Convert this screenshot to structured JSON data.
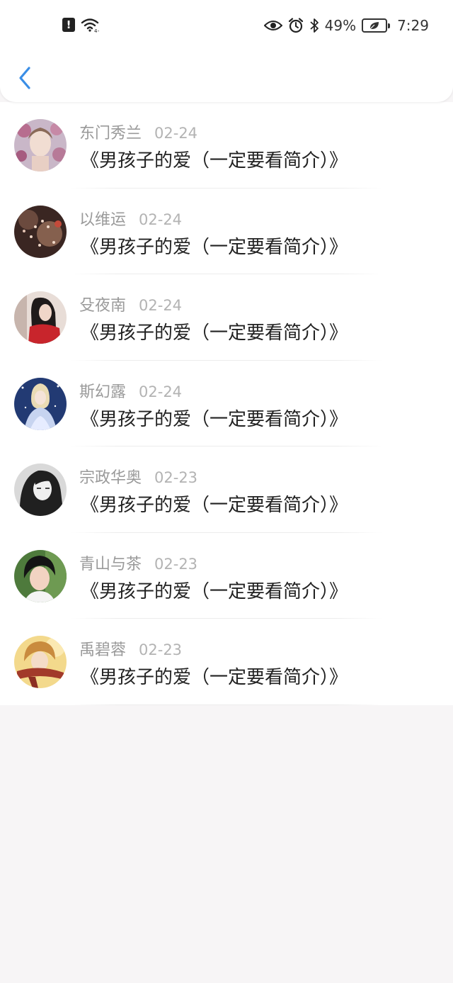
{
  "status_bar": {
    "battery": "49%",
    "time": "7:29"
  },
  "header": {
    "back_icon": "chevron-left-icon",
    "accent_color": "#3a8ee6"
  },
  "posts": [
    {
      "author": "东门秀兰",
      "date": "02-24",
      "title": "《男孩子的爱（一定要看简介）》"
    },
    {
      "author": "以维运",
      "date": "02-24",
      "title": "《男孩子的爱（一定要看简介）》"
    },
    {
      "author": "殳夜南",
      "date": "02-24",
      "title": "《男孩子的爱（一定要看简介）》"
    },
    {
      "author": "斯幻露",
      "date": "02-24",
      "title": "《男孩子的爱（一定要看简介）》"
    },
    {
      "author": "宗政华奥",
      "date": "02-23",
      "title": "《男孩子的爱（一定要看简介）》"
    },
    {
      "author": "青山与茶",
      "date": "02-23",
      "title": "《男孩子的爱（一定要看简介）》"
    },
    {
      "author": "禹碧蓉",
      "date": "02-23",
      "title": "《男孩子的爱（一定要看简介）》"
    }
  ]
}
